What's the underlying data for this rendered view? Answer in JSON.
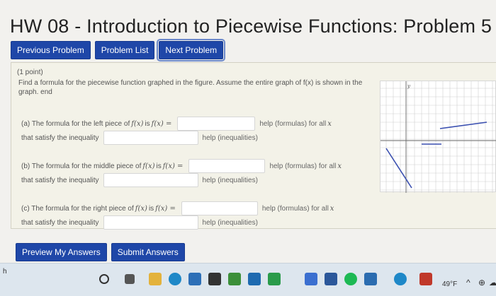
{
  "page_title": "HW 08 - Introduction to Piecewise Functions: Problem 5",
  "nav": {
    "previous": "Previous Problem",
    "list": "Problem List",
    "next": "Next Problem"
  },
  "problem": {
    "points": "(1 point)",
    "description": "Find a formula for the piecewise function graphed in the figure. Assume the entire graph of f(x) is shown in the graph. end",
    "parts": [
      {
        "formula_label_pre": "(a) The formula for the left piece of",
        "fx": "f(x)",
        "is": "is",
        "fx_eq": "f(x) =",
        "help_formulas": "help (formulas) for all",
        "x": "x",
        "ineq_label": "that satisfy the inequality",
        "help_ineq": "help (inequalities)"
      },
      {
        "formula_label_pre": "(b) The formula for the middle piece of",
        "fx": "f(x)",
        "is": "is",
        "fx_eq": "f(x) =",
        "help_formulas": "help (formulas) for all",
        "x": "x",
        "ineq_label": "that satisfy the inequality",
        "help_ineq": "help (inequalities)"
      },
      {
        "formula_label_pre": "(c) The formula for the right piece of",
        "fx": "f(x)",
        "is": "is",
        "fx_eq": "f(x) =",
        "help_formulas": "help (formulas) for all",
        "x": "x",
        "ineq_label": "that satisfy the inequality",
        "help_ineq": "help (inequalities)"
      }
    ]
  },
  "actions": {
    "preview": "Preview My Answers",
    "submit": "Submit Answers"
  },
  "graph": {
    "y_label": "y"
  },
  "taskbar": {
    "left_text": "h",
    "weather": "49°F",
    "up_arrow": "^",
    "drive_symbol": "⊕",
    "wifi_symbol": "☁"
  },
  "colors": {
    "button_blue": "#1f47a8",
    "graph_line": "#3a4fb0"
  }
}
